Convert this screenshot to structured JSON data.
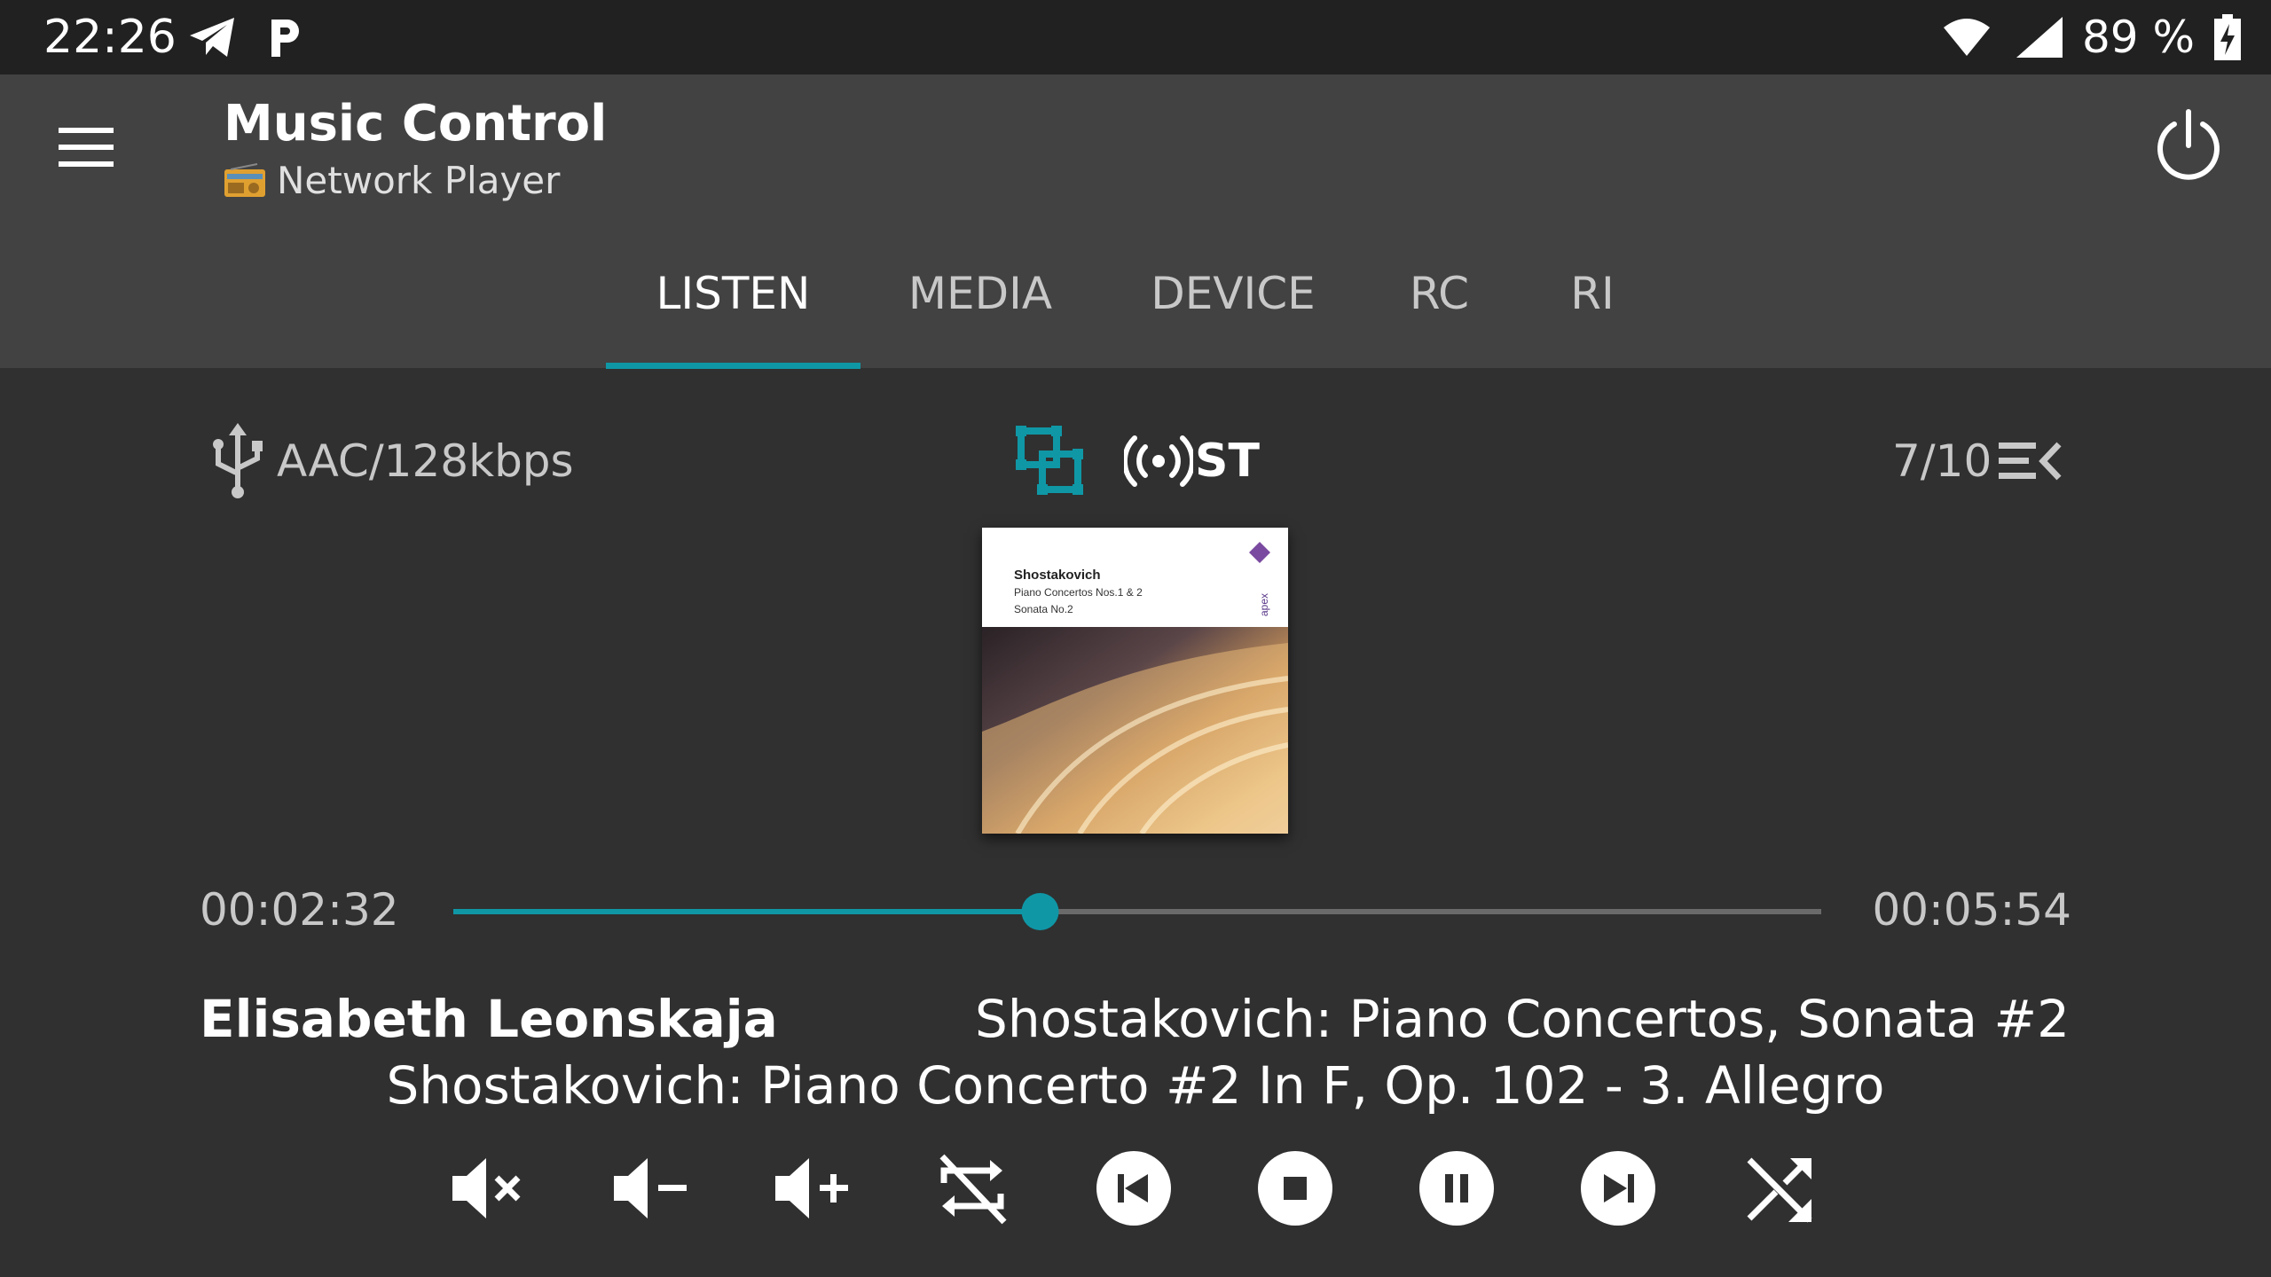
{
  "status_bar": {
    "time": "22:26",
    "battery_pct": "89 %",
    "icons": [
      "telegram-icon",
      "parking-icon",
      "wifi-icon",
      "signal-icon",
      "battery-charging-icon"
    ]
  },
  "app_bar": {
    "title": "Music Control",
    "subtitle": "Network Player",
    "icons": [
      "menu-icon",
      "radio-icon",
      "power-icon"
    ]
  },
  "tabs": [
    {
      "label": "LISTEN",
      "active": true
    },
    {
      "label": "MEDIA",
      "active": false
    },
    {
      "label": "DEVICE",
      "active": false
    },
    {
      "label": "RC",
      "active": false
    },
    {
      "label": "RI",
      "active": false
    }
  ],
  "info": {
    "format": "AAC/128kbps",
    "stereo": "ST",
    "queue_position": "7/10",
    "icons": [
      "usb-icon",
      "network-icon",
      "broadcast-icon",
      "queue-icon"
    ]
  },
  "album_art": {
    "composer": "Shostakovich",
    "line1": "Piano Concertos Nos.1 & 2",
    "line2": "Sonata No.2",
    "label": "apex"
  },
  "playback": {
    "elapsed": "00:02:32",
    "total": "00:05:54",
    "progress": 0.429
  },
  "track": {
    "artist": "Elisabeth Leonskaja",
    "album": "Shostakovich: Piano Concertos, Sonata #2",
    "title": "Shostakovich: Piano Concerto #2 In F, Op. 102 - 3. Allegro"
  },
  "controls": [
    "mute-icon",
    "volume-down-icon",
    "volume-up-icon",
    "repeat-off-icon",
    "previous-icon",
    "stop-icon",
    "pause-icon",
    "next-icon",
    "shuffle-icon"
  ],
  "colors": {
    "accent": "#0f97a6",
    "background": "#303030",
    "app_bar": "#424242",
    "status_bar": "#212121"
  }
}
